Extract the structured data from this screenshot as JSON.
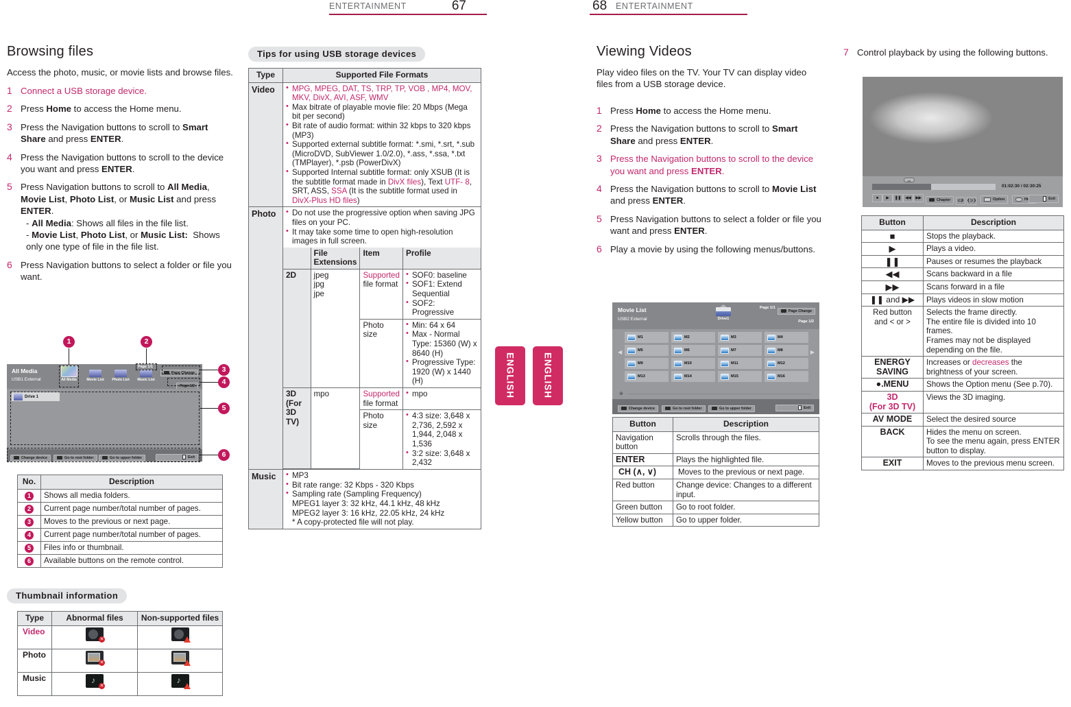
{
  "headers": {
    "left": {
      "label": "ENTERTAINMENT",
      "page": "67"
    },
    "right": {
      "label": "ENTERTAINMENT",
      "page": "68"
    }
  },
  "side_tabs": {
    "label": "ENGLISH"
  },
  "col1": {
    "title": "Browsing files",
    "intro": "Access the photo, music, or movie lists and browse files.",
    "steps": [
      {
        "num": "1",
        "html": "Connect a USB storage device."
      },
      {
        "num": "2",
        "html": "Press Home to access the Home menu."
      },
      {
        "num": "3",
        "html": "Press the Navigation buttons to scroll to Smart Share and press ENTER."
      },
      {
        "num": "4",
        "html": "Press the Navigation buttons to scroll to the device you want and press ENTER."
      },
      {
        "num": "5",
        "html": "Press Navigation buttons to scroll to All Media, Movie List, Photo List, or Music List and press ENTER. - All Media: Shows all files in the file list. - Movie List, Photo List, or Music List: Shows only one type of file in the file list."
      },
      {
        "num": "6",
        "html": "Press Navigation buttons to select a folder or file you want."
      }
    ],
    "osd": {
      "title": "All Media",
      "device": "USB1 External",
      "tabs": [
        "All Media",
        "Movie List",
        "Photo List",
        "Music List"
      ],
      "page_top": "Page 1/1",
      "page_change": "Page Change",
      "page_bottom": "Page 1/2",
      "drive": "Drive 1",
      "buttons": [
        "Change device",
        "Go to root folder",
        "Go to upper folder",
        "Exit"
      ],
      "callouts": [
        "1",
        "2",
        "3",
        "4",
        "5",
        "6"
      ]
    },
    "no_table": {
      "headers": [
        "No.",
        "Description"
      ],
      "rows": [
        {
          "no": "1",
          "desc": "Shows all media folders."
        },
        {
          "no": "2",
          "desc": "Current page number/total number of pages."
        },
        {
          "no": "3",
          "desc": "Moves to the previous or next page."
        },
        {
          "no": "4",
          "desc": "Current page number/total number of pages."
        },
        {
          "no": "5",
          "desc": "Files info or thumbnail."
        },
        {
          "no": "6",
          "desc": "Available buttons on the remote control."
        }
      ]
    },
    "thumb_title": "Thumbnail information",
    "thumb_table": {
      "headers": [
        "Type",
        "Abnormal files",
        "Non-supported files"
      ],
      "rows": [
        "Video",
        "Photo",
        "Music"
      ]
    }
  },
  "col2": {
    "pill": "Tips for using USB storage devices",
    "table_headers": [
      "Type",
      "Supported File Formats"
    ],
    "video": {
      "label": "Video",
      "items": [
        "MPG, MPEG, DAT, TS, TRP, TP, VOB   , MP4, MOV, MKV, DivX, AVI, ASF, WMV",
        "Max bitrate of playable movie file: 20 Mbps (Mega bit per second)",
        "Bit rate of audio format: within 32 kbps to 320 kbps (MP3)",
        "Supported external subtitle format: *.smi, *.srt, *.sub (MicroDVD, SubViewer 1.0/2.0), *.ass, *.ssa, *.txt (TMPlayer), *.psb (PowerDivX)",
        "Supported Internal subtitle format: only XSUB (It is the subtitle format made in DivX files), Text UTF- 8, SRT, ASS, SSA (It is the subtitle format used in DivX-Plus HD files)"
      ]
    },
    "photo": {
      "label": "Photo",
      "items": [
        "Do not use the progressive option when saving JPG files on your PC.",
        "It may take some time to open high-resolution images in full screen."
      ],
      "sub_headers": [
        "",
        "File Extensions",
        "Item",
        "Profile"
      ],
      "rows_2d": {
        "dim": "2D",
        "ext": "jpeg\njpg\njpe",
        "item1": "Supported file format",
        "profile1": [
          "SOF0: baseline",
          "SOF1: Extend Sequential",
          "SOF2: Progressive"
        ],
        "item2": "Photo size",
        "profile2": [
          "Min: 64 x 64",
          "Max - Normal Type: 15360 (W) x 8640 (H)",
          "Progressive Type: 1920 (W) x 1440 (H)"
        ]
      },
      "rows_3d": {
        "dim": "3D (For 3D TV)",
        "ext": "mpo",
        "item1": "Supported file format",
        "profile1": [
          "mpo"
        ],
        "item2": "Photo size",
        "profile2": [
          "4:3 size: 3,648 x 2,736, 2,592 x 1,944, 2,048 x 1,536",
          "3:2 size: 3,648 x 2,432"
        ]
      }
    },
    "music": {
      "label": "Music",
      "items": [
        "MP3",
        "Bit rate range: 32 Kbps - 320 Kbps",
        "Sampling rate (Sampling Frequency)\nMPEG1 layer 3: 32 kHz, 44.1 kHz, 48 kHz\nMPEG2 layer 3: 16 kHz, 22.05 kHz, 24 kHz\n* A copy-protected file will not play."
      ]
    }
  },
  "col3": {
    "title": "Viewing Videos",
    "intro": "Play video files on the TV. Your TV can display video files from a USB storage device.",
    "steps": [
      {
        "num": "1",
        "html": "Press Home to access the Home menu."
      },
      {
        "num": "2",
        "html": "Press the Navigation buttons to scroll to Smart Share and press ENTER."
      },
      {
        "num": "3",
        "html": "Press the Navigation buttons to scroll to the device you want and press ENTER."
      },
      {
        "num": "4",
        "html": "Press the Navigation buttons to scroll to Movie List and press ENTER."
      },
      {
        "num": "5",
        "html": "Press Navigation buttons to select a folder or file you want and press ENTER."
      },
      {
        "num": "6",
        "html": "Play a movie by using the following menus/buttons."
      }
    ],
    "osd": {
      "title": "Movie List",
      "device": "USB2 External",
      "drive": "Drive1",
      "page_top": "Page 1/1",
      "page_change": "Page Change",
      "page_bottom": "Page 1/2",
      "files": [
        "M1",
        "M2",
        "M3",
        "M4",
        "M5",
        "M6",
        "M7",
        "M8",
        "M9",
        "M10",
        "M11",
        "M12",
        "M13",
        "M14",
        "M15",
        "M16"
      ],
      "buttons": [
        "Change device",
        "Go to root folder",
        "Go to upper folder",
        "Exit"
      ]
    },
    "button_table": {
      "headers": [
        "Button",
        "Description"
      ],
      "rows": [
        {
          "button": "Navigation button",
          "desc": "Scrolls through the files."
        },
        {
          "button": "ENTER",
          "desc": "Plays the highlighted file."
        },
        {
          "button": "CH (∧, ∨)",
          "desc": "Moves to the previous or next page."
        },
        {
          "button": "Red button",
          "desc": "Change device: Changes to a different input."
        },
        {
          "button": "Green button",
          "desc": "Go to root folder."
        },
        {
          "button": "Yellow button",
          "desc": "Go to upper folder."
        }
      ]
    }
  },
  "col4": {
    "step": {
      "num": "7",
      "html": "Control playback by using the following buttons."
    },
    "player": {
      "time": "01:02:30 / 02:30:25",
      "buttons": [
        "Chapter",
        "Option",
        "Hide",
        "Exit"
      ]
    },
    "button_table": {
      "headers": [
        "Button",
        "Description"
      ],
      "rows": [
        {
          "button": "■",
          "desc": "Stops the playback."
        },
        {
          "button": "▶",
          "desc": "Plays a video."
        },
        {
          "button": "❚❚",
          "desc": "Pauses or resumes the playback"
        },
        {
          "button": "◀◀",
          "desc": "Scans backward in a file"
        },
        {
          "button": "▶▶",
          "desc": "Scans forward in a file"
        },
        {
          "button": "❚❚ and ▶▶",
          "desc": "Plays videos in slow motion"
        },
        {
          "button": "Red button and < or >",
          "desc": "Selects the frame directly.\nThe entire file is divided into 10 frames.\nFrames may not be displayed depending on the file."
        },
        {
          "button": "ENERGY SAVING",
          "desc": "Increases or decreases the brightness of your screen."
        },
        {
          "button": "●.MENU",
          "desc": "Shows the Option menu (See p.70)."
        },
        {
          "button": "3D (For 3D TV)",
          "desc": "Views the 3D imaging."
        },
        {
          "button": "AV MODE",
          "desc": "Select the desired source"
        },
        {
          "button": "BACK",
          "desc": "Hides the menu on screen.\nTo see the menu again, press ENTER button to display."
        },
        {
          "button": "EXIT",
          "desc": "Moves to the previous menu screen."
        }
      ]
    }
  },
  "colors": {
    "accent": "#c2276c",
    "rule": "#a41c4a",
    "tab": "#d12b63"
  }
}
